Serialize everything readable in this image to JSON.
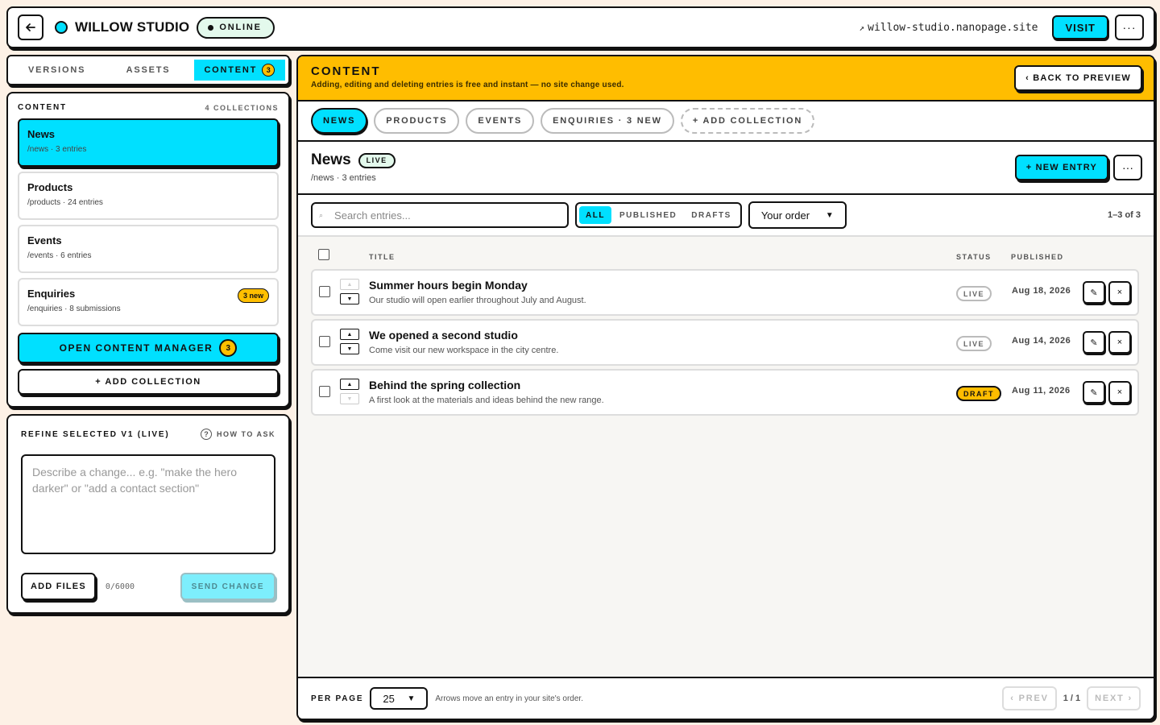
{
  "header": {
    "back_icon": "arrow-left-icon",
    "site_name": "WILLOW STUDIO",
    "status": "ONLINE",
    "url": "willow-studio.nanopage.site",
    "url_icon": "external-arrow-icon",
    "visit_label": "VISIT",
    "more_label": "···",
    "accent": "#00e0ff"
  },
  "left_tabs": [
    {
      "label": "VERSIONS"
    },
    {
      "label": "ASSETS"
    },
    {
      "label": "CONTENT",
      "badge": "3"
    }
  ],
  "content_panel": {
    "title": "CONTENT",
    "count": "4 COLLECTIONS",
    "collections": [
      {
        "name": "News",
        "meta": "/news · 3 entries"
      },
      {
        "name": "Products",
        "meta": "/products · 24 entries"
      },
      {
        "name": "Events",
        "meta": "/events · 6 entries"
      },
      {
        "name": "Enquiries",
        "meta": "/enquiries · 8 submissions",
        "badge": "3 new"
      }
    ],
    "open_manager_label": "OPEN CONTENT MANAGER",
    "open_manager_badge": "3",
    "add_collection_label": "+ ADD COLLECTION"
  },
  "refine": {
    "title": "REFINE SELECTED V1 (LIVE)",
    "how_to": "HOW TO ASK",
    "placeholder": "Describe a change... e.g. \"make the hero darker\" or \"add a contact section\"",
    "add_files": "ADD FILES",
    "char_count": "0/6000",
    "send": "SEND CHANGE"
  },
  "main": {
    "banner_title": "CONTENT",
    "banner_sub": "Adding, editing and deleting entries is free and instant — no site change used.",
    "back_preview": "‹ BACK TO PREVIEW",
    "tabs": [
      {
        "label": "NEWS"
      },
      {
        "label": "PRODUCTS"
      },
      {
        "label": "EVENTS"
      },
      {
        "label": "ENQUIRIES · 3 NEW"
      },
      {
        "label": "+ ADD COLLECTION"
      }
    ],
    "collection_name": "News",
    "collection_status": "LIVE",
    "collection_meta": "/news · 3 entries",
    "new_entry": "+ NEW ENTRY",
    "more_label": "···",
    "search_placeholder": "Search entries...",
    "filters": [
      "ALL",
      "PUBLISHED",
      "DRAFTS"
    ],
    "order": "Your order",
    "range": "1–3 of 3",
    "columns": {
      "title": "TITLE",
      "status": "STATUS",
      "published": "PUBLISHED"
    },
    "entries": [
      {
        "title": "Summer hours begin Monday",
        "excerpt": "Our studio will open earlier throughout July and August.",
        "status": "LIVE",
        "date": "Aug 18, 2026"
      },
      {
        "title": "We opened a second studio",
        "excerpt": "Come visit our new workspace in the city centre.",
        "status": "LIVE",
        "date": "Aug 14, 2026"
      },
      {
        "title": "Behind the spring collection",
        "excerpt": "A first look at the materials and ideas behind the new range.",
        "status": "DRAFT",
        "date": "Aug 11, 2026"
      }
    ],
    "per_page_label": "PER PAGE",
    "per_page": "25",
    "hint": "Arrows move an entry in your site's order.",
    "prev": "‹ PREV",
    "page": "1 / 1",
    "next": "NEXT ›"
  }
}
